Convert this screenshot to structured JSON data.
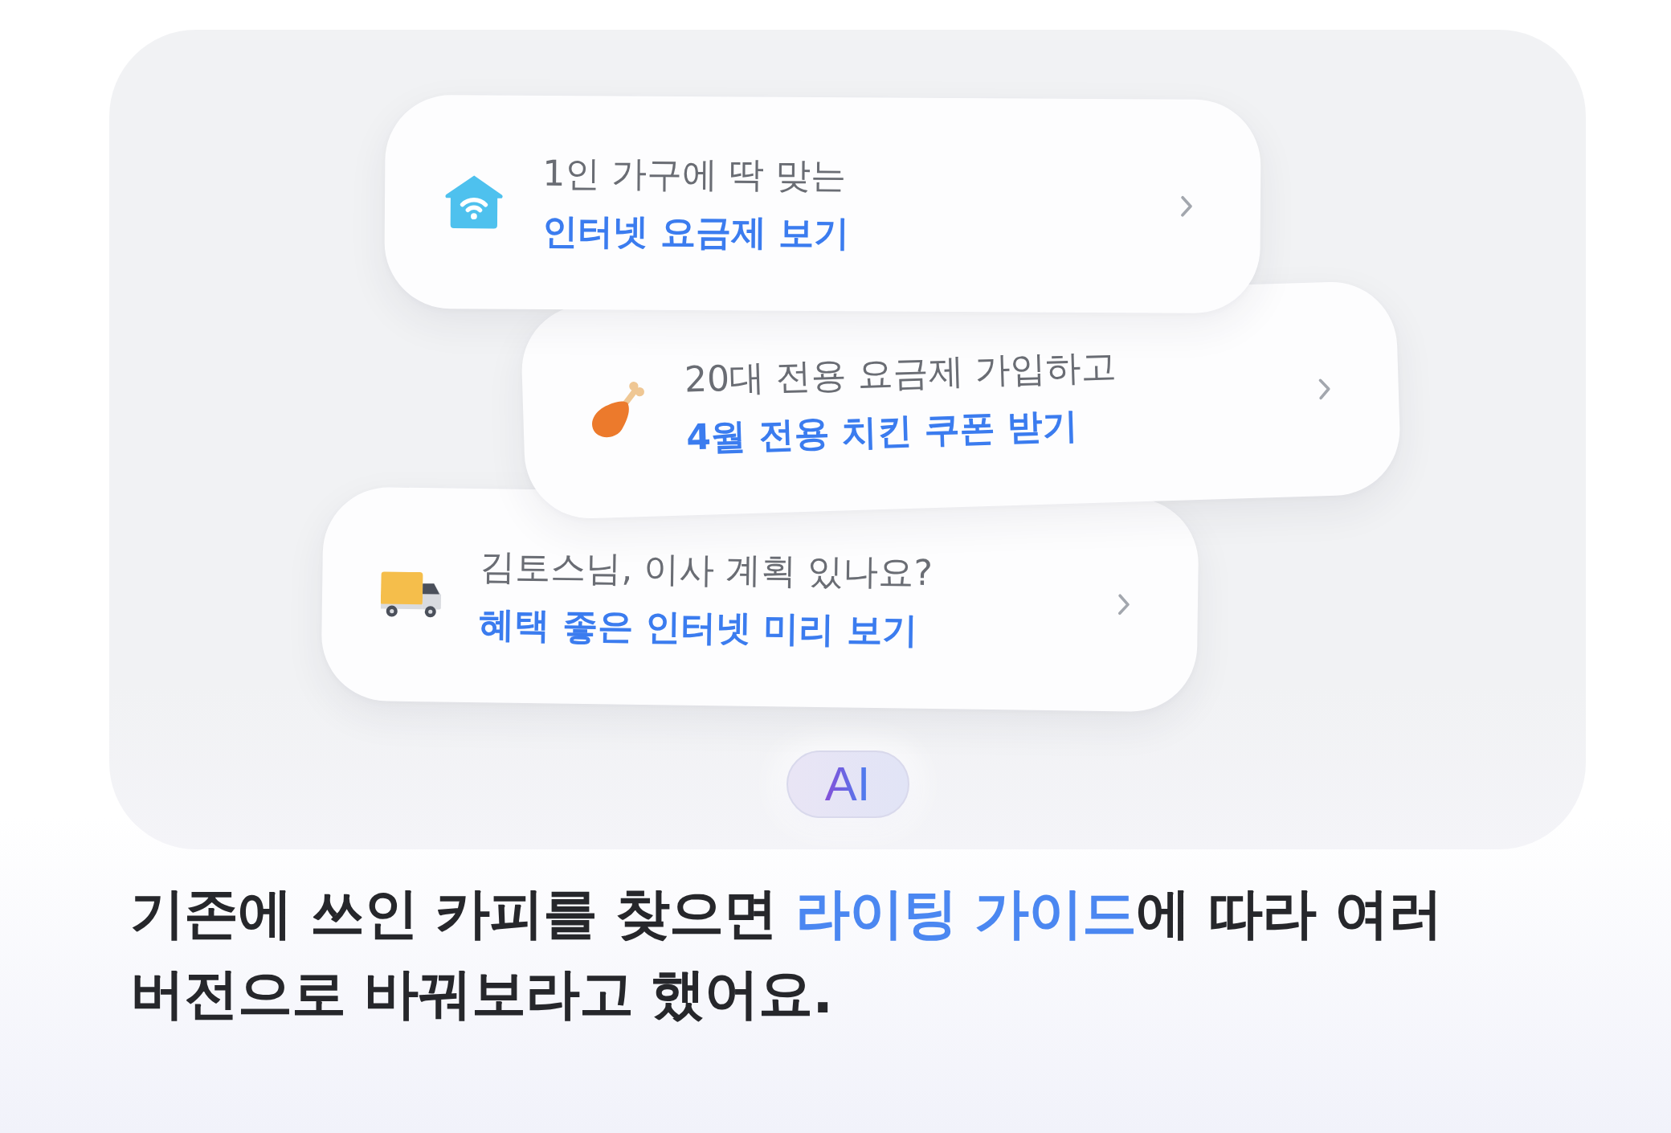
{
  "panel": {
    "cards": [
      {
        "subtitle": "1인 가구에 딱 맞는",
        "title": "인터넷 요금제 보기"
      },
      {
        "subtitle": "20대 전용 요금제 가입하고",
        "title": "4월 전용 치킨 쿠폰 받기"
      },
      {
        "subtitle": "김토스님, 이사 계획 있나요?",
        "title": "혜택 좋은 인터넷 미리 보기"
      }
    ],
    "badge": "AI"
  },
  "caption": {
    "parts": [
      {
        "text": "기존에 쓰인 카피를 찾으면 ",
        "highlight": false
      },
      {
        "text": "라이팅 가이드",
        "highlight": true
      },
      {
        "text": "에 따라 여러 버전으로 바꿔보라고 했어요.",
        "highlight": false
      }
    ]
  }
}
